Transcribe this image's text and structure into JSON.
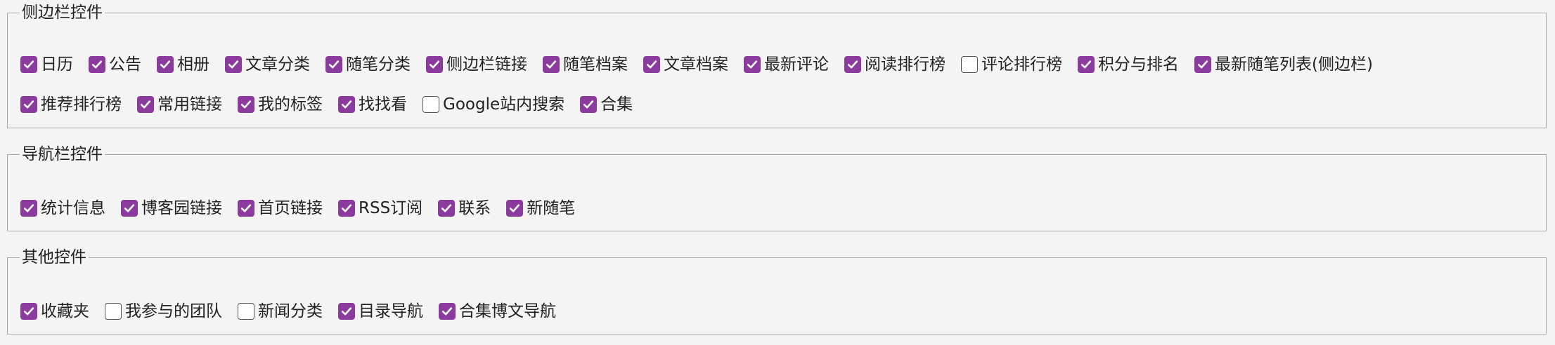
{
  "accent_color": "#8b3a9e",
  "groups": {
    "sidebar": {
      "title": "侧边栏控件",
      "rows": [
        [
          {
            "label": "日历",
            "checked": true
          },
          {
            "label": "公告",
            "checked": true
          },
          {
            "label": "相册",
            "checked": true
          },
          {
            "label": "文章分类",
            "checked": true
          },
          {
            "label": "随笔分类",
            "checked": true
          },
          {
            "label": "侧边栏链接",
            "checked": true
          },
          {
            "label": "随笔档案",
            "checked": true
          },
          {
            "label": "文章档案",
            "checked": true
          },
          {
            "label": "最新评论",
            "checked": true
          },
          {
            "label": "阅读排行榜",
            "checked": true
          },
          {
            "label": "评论排行榜",
            "checked": false
          },
          {
            "label": "积分与排名",
            "checked": true
          },
          {
            "label": "最新随笔列表(侧边栏)",
            "checked": true
          }
        ],
        [
          {
            "label": "推荐排行榜",
            "checked": true
          },
          {
            "label": "常用链接",
            "checked": true
          },
          {
            "label": "我的标签",
            "checked": true
          },
          {
            "label": "找找看",
            "checked": true
          },
          {
            "label": "Google站内搜索",
            "checked": false
          },
          {
            "label": "合集",
            "checked": true
          }
        ]
      ]
    },
    "nav": {
      "title": "导航栏控件",
      "rows": [
        [
          {
            "label": "统计信息",
            "checked": true
          },
          {
            "label": "博客园链接",
            "checked": true
          },
          {
            "label": "首页链接",
            "checked": true
          },
          {
            "label": "RSS订阅",
            "checked": true
          },
          {
            "label": "联系",
            "checked": true
          },
          {
            "label": "新随笔",
            "checked": true
          }
        ]
      ]
    },
    "other": {
      "title": "其他控件",
      "rows": [
        [
          {
            "label": "收藏夹",
            "checked": true
          },
          {
            "label": "我参与的团队",
            "checked": false
          },
          {
            "label": "新闻分类",
            "checked": false
          },
          {
            "label": "目录导航",
            "checked": true
          },
          {
            "label": "合集博文导航",
            "checked": true
          }
        ]
      ]
    }
  }
}
